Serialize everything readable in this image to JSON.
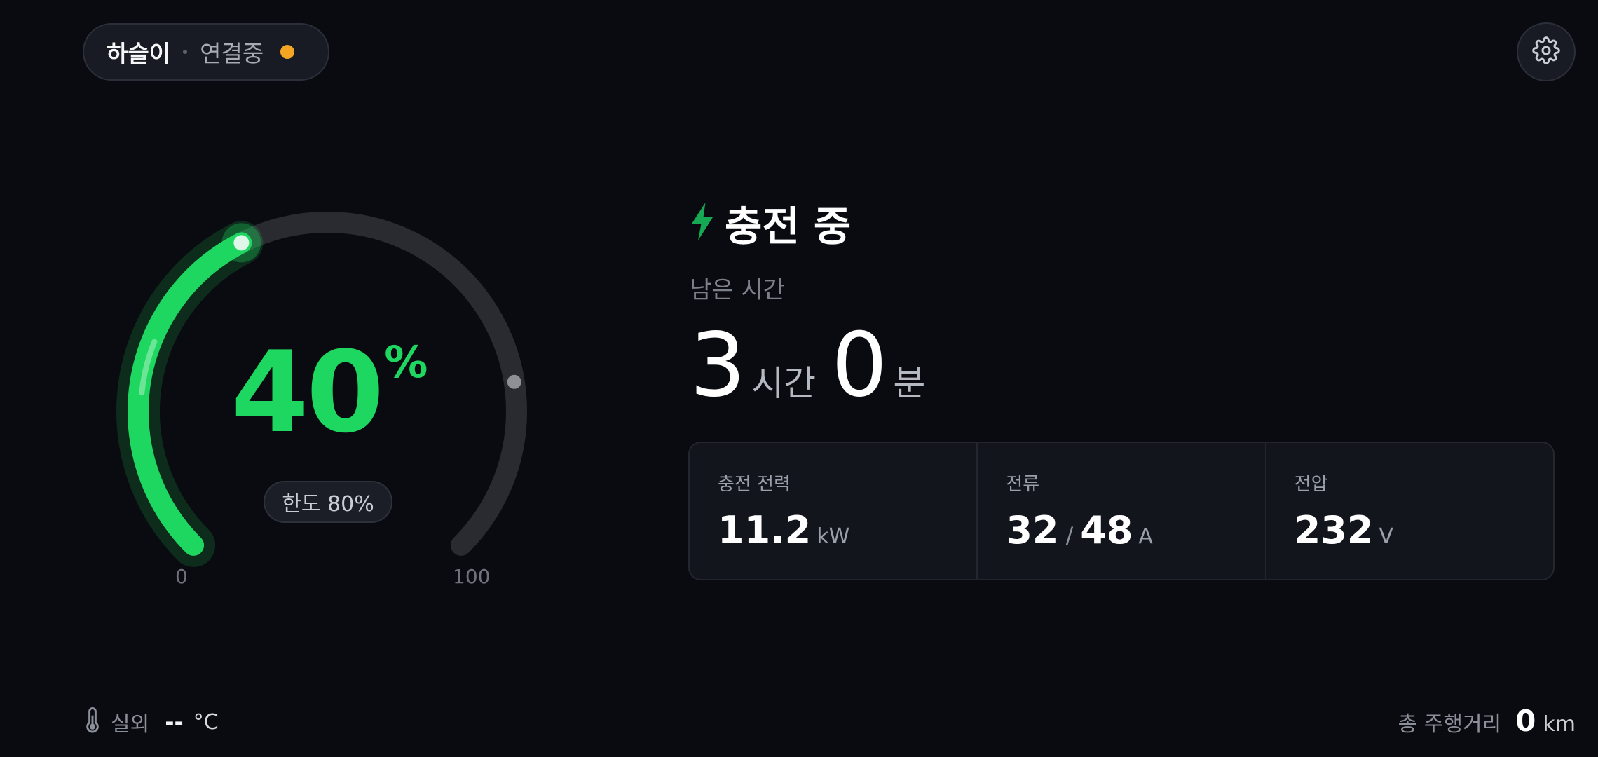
{
  "vehicle": {
    "name": "하슬이",
    "connection_status": "연결중",
    "status_color": "#f5a524"
  },
  "icons": {
    "settings": "gear-icon",
    "charging": "lightning-bolt-icon",
    "temperature": "thermometer-icon"
  },
  "gauge": {
    "battery_percent": "40",
    "percent_sign": "%",
    "limit_label": "한도 80%",
    "limit_percent": 80,
    "min_label": "0",
    "max_label": "100",
    "fill_color": "#1ed760",
    "track_color": "#2a2b30"
  },
  "charging": {
    "status_title": "충전 중",
    "remaining_label": "남은 시간",
    "remaining_hours": "3",
    "hours_unit": "시간",
    "remaining_minutes": "0",
    "minutes_unit": "분"
  },
  "stats": {
    "power_label": "충전 전력",
    "power_value": "11.2",
    "power_unit": "kW",
    "current_label": "전류",
    "current_value": "32",
    "current_separator": "/",
    "current_max": "48",
    "current_unit": "A",
    "voltage_label": "전압",
    "voltage_value": "232",
    "voltage_unit": "V"
  },
  "footer": {
    "outdoor_label": "실외",
    "outdoor_temp": "--",
    "temp_unit": "°C",
    "odometer_label": "총 주행거리",
    "odometer_value": "0",
    "odometer_unit": "km"
  }
}
